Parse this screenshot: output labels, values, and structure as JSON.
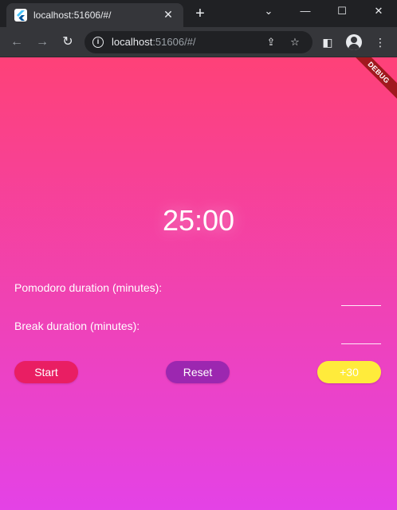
{
  "browser": {
    "tab_title": "localhost:51606/#/",
    "url_host": "localhost",
    "url_rest": ":51606/#/"
  },
  "app": {
    "debug_banner": "DEBUG",
    "timer": "25:00",
    "pomodoro_label": "Pomodoro duration (minutes):",
    "pomodoro_value": "",
    "break_label": "Break duration (minutes):",
    "break_value": "",
    "start_label": "Start",
    "reset_label": "Reset",
    "plus_label": "+30"
  },
  "colors": {
    "gradient_top": "#fe4178",
    "gradient_bottom": "#e442e6",
    "start_button": "#e91e63",
    "reset_button": "#9c27b0",
    "plus_button": "#ffeb3b"
  },
  "icons": [
    "flutter-favicon-icon",
    "close-icon",
    "plus-icon",
    "minimize-icon",
    "maximize-icon",
    "window-close-icon",
    "back-icon",
    "forward-icon",
    "reload-icon",
    "info-icon",
    "share-icon",
    "star-icon",
    "side-panel-icon",
    "profile-icon",
    "menu-icon",
    "chevron-down-icon"
  ]
}
